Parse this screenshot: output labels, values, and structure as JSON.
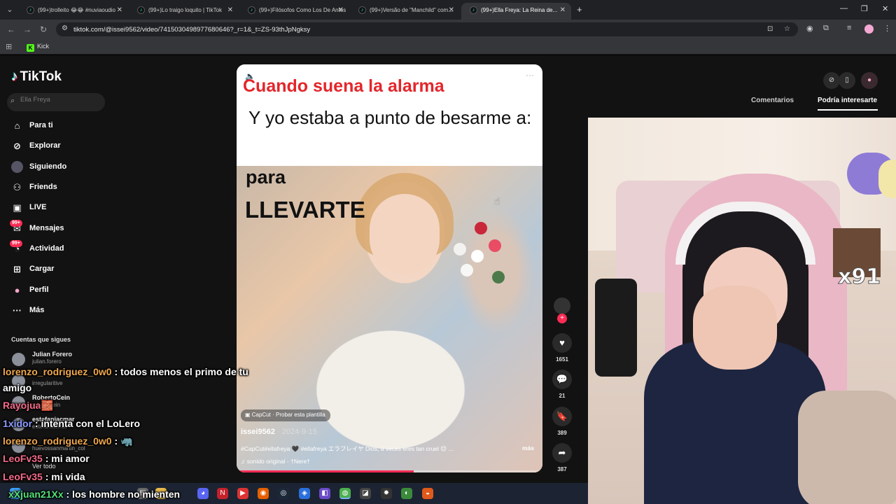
{
  "browser": {
    "tabs": [
      {
        "title": "(99+)trolleito 😂😂 #nuviaoudio"
      },
      {
        "title": "(99+)Lo traigo loquito | TikTok"
      },
      {
        "title": "(99+)Filósofos Como Los De Antes"
      },
      {
        "title": "(99+)Versão de \"Manchild\" com..."
      },
      {
        "title": "(99+)Ella Freya: La Reina de..."
      }
    ],
    "url": "tiktok.com/@issei9562/video/7415030498977680646?_r=1&_t=ZS-93thJpNgksy",
    "bookmark": "Kick"
  },
  "sidebar": {
    "logo": "TikTok",
    "search_placeholder": "Ella Freya",
    "nav": [
      {
        "label": "Para ti"
      },
      {
        "label": "Explorar"
      },
      {
        "label": "Siguiendo"
      },
      {
        "label": "Friends"
      },
      {
        "label": "LIVE"
      },
      {
        "label": "Mensajes",
        "badge": "99+"
      },
      {
        "label": "Actividad",
        "badge": "99+"
      },
      {
        "label": "Cargar"
      },
      {
        "label": "Perfil"
      },
      {
        "label": "Más"
      }
    ],
    "following_title": "Cuentas que sigues",
    "accounts": [
      {
        "name": "Julian Forero",
        "handle": "julian.forero"
      },
      {
        "name": "",
        "handle": "irregularitive"
      },
      {
        "name": "RobertoCein",
        "handle": "robertocein"
      },
      {
        "name": "estefaniacmar",
        "handle": "estefaniacmar"
      },
      {
        "name": "",
        "handle": "huevossanmartin_col"
      }
    ],
    "see_all": "Ver todo"
  },
  "video": {
    "headline": "Cuando suena la alarma",
    "caption": "Y yo estaba a punto de besarme a:",
    "overlay_line1": "para",
    "overlay_line2": "LLEVARTE",
    "capcut": "CapCut · Probar esta plantilla",
    "author": "issei9562",
    "date": "· 2024-9-15",
    "description": "#CapCut#ellafreya 🖤 #ellafreya エラフレイヤ Dios, a veces eres tan cruel 😌 ...",
    "more": "más",
    "sound": "♫  sonido original - †Nere†",
    "progress": 0.58
  },
  "actions": {
    "likes": "1651",
    "comments": "21",
    "saves": "389",
    "shares": "387"
  },
  "right_panel": {
    "tab_comments": "Comentarios",
    "tab_interest": "Podría interesarte"
  },
  "stream": {
    "emote_count": "x91"
  },
  "chat": [
    {
      "user": "lorenzo_rodriguez_0w0",
      "text": " : todos menos el primo de tu"
    },
    {
      "user": "",
      "text": "amigo"
    },
    {
      "user": "Rayojua",
      "text": "🧱"
    },
    {
      "user": "1xidor",
      "text": " : intenta con el LoLero"
    },
    {
      "user": "lorenzo_rodriguez_0w0",
      "text": " : 🦏"
    },
    {
      "user": "LeoFv35",
      "text": " : mi amor"
    },
    {
      "user": "LeoFv35",
      "text": " : mi vida"
    },
    {
      "user": "xXjuan21Xx",
      "text": " : los hombre no mienten"
    }
  ]
}
